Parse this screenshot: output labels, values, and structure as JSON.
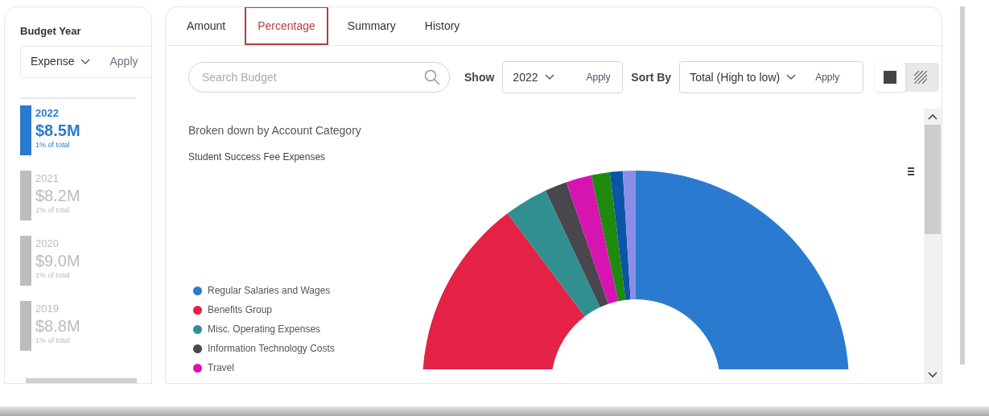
{
  "sidebar": {
    "title": "Budget Year",
    "type_select": "Expense",
    "apply": "Apply",
    "years": [
      {
        "year": "2022",
        "amount": "$8.5M",
        "share": "1% of total",
        "selected": true
      },
      {
        "year": "2021",
        "amount": "$8.2M",
        "share": "1% of total",
        "selected": false
      },
      {
        "year": "2020",
        "amount": "$9.0M",
        "share": "1% of total",
        "selected": false
      },
      {
        "year": "2019",
        "amount": "$8.8M",
        "share": "1% of total",
        "selected": false
      }
    ]
  },
  "tabs": [
    {
      "label": "Amount",
      "selected": false
    },
    {
      "label": "Percentage",
      "selected": true
    },
    {
      "label": "Summary",
      "selected": false
    },
    {
      "label": "History",
      "selected": false
    }
  ],
  "toolbar": {
    "search": {
      "placeholder": "Search Budget"
    },
    "show_label": "Show",
    "show_value": "2022",
    "show_apply": "Apply",
    "sort_label": "Sort By",
    "sort_value": "Total (High to low)",
    "sort_apply": "Apply",
    "view_toggles": [
      {
        "kind": "solid",
        "selected": true
      },
      {
        "kind": "hatched",
        "selected": false
      }
    ]
  },
  "chart": {
    "title": "Broken down by Account Category",
    "subtitle": "Student Success Fee Expenses",
    "legend": [
      {
        "label": "Regular Salaries and Wages",
        "color": "#2a7bd0"
      },
      {
        "label": "Benefits Group",
        "color": "#e32245"
      },
      {
        "label": "Misc. Operating Expenses",
        "color": "#31908f"
      },
      {
        "label": "Information Technology Costs",
        "color": "#47474d"
      },
      {
        "label": "Travel",
        "color": "#d615b1"
      }
    ]
  }
}
